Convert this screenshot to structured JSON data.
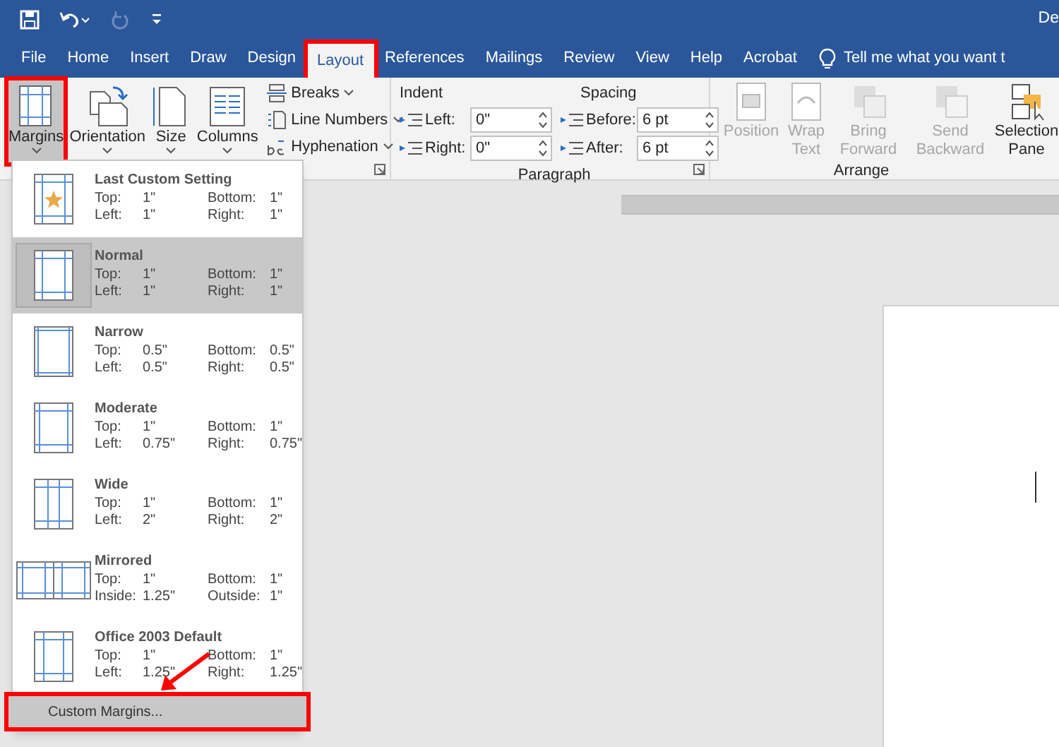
{
  "title_bar": {
    "title": "De"
  },
  "tabs": [
    {
      "label": "File",
      "selected": false,
      "highlighted": false
    },
    {
      "label": "Home",
      "selected": false,
      "highlighted": false
    },
    {
      "label": "Insert",
      "selected": false,
      "highlighted": false
    },
    {
      "label": "Draw",
      "selected": false,
      "highlighted": false
    },
    {
      "label": "Design",
      "selected": false,
      "highlighted": false
    },
    {
      "label": "Layout",
      "selected": true,
      "highlighted": true
    },
    {
      "label": "References",
      "selected": false,
      "highlighted": false
    },
    {
      "label": "Mailings",
      "selected": false,
      "highlighted": false
    },
    {
      "label": "Review",
      "selected": false,
      "highlighted": false
    },
    {
      "label": "View",
      "selected": false,
      "highlighted": false
    },
    {
      "label": "Help",
      "selected": false,
      "highlighted": false
    },
    {
      "label": "Acrobat",
      "selected": false,
      "highlighted": false
    }
  ],
  "tell_me": {
    "text": "Tell me what you want t"
  },
  "page_setup": {
    "large_buttons": [
      {
        "kind": "margins",
        "label": "Margins",
        "pressed": true,
        "highlighted": true
      },
      {
        "kind": "orientation",
        "label": "Orientation",
        "pressed": false,
        "highlighted": false
      },
      {
        "kind": "size",
        "label": "Size",
        "pressed": false,
        "highlighted": false
      },
      {
        "kind": "columns",
        "label": "Columns",
        "pressed": false,
        "highlighted": false
      }
    ],
    "small_buttons": [
      {
        "kind": "breaks",
        "label": "Breaks"
      },
      {
        "kind": "line_numbers",
        "label": "Line Numbers"
      },
      {
        "kind": "hyphenation",
        "label": "Hyphenation"
      }
    ]
  },
  "paragraph": {
    "group_label": "Paragraph",
    "indent": {
      "label": "Indent",
      "left": {
        "label": "Left:",
        "value": "0\""
      },
      "right": {
        "label": "Right:",
        "value": "0\""
      }
    },
    "spacing": {
      "label": "Spacing",
      "before": {
        "label": "Before:",
        "value": "6 pt"
      },
      "after": {
        "label": "After:",
        "value": "6 pt"
      }
    }
  },
  "arrange": {
    "group_label": "Arrange",
    "buttons": [
      {
        "kind": "position",
        "lines": [
          "Position"
        ],
        "disabled": true
      },
      {
        "kind": "wrap",
        "lines": [
          "Wrap",
          "Text"
        ],
        "disabled": true
      },
      {
        "kind": "forward",
        "lines": [
          "Bring",
          "Forward"
        ],
        "disabled": true
      },
      {
        "kind": "backward",
        "lines": [
          "Send",
          "Backward"
        ],
        "disabled": true
      },
      {
        "kind": "selection",
        "lines": [
          "Selection",
          "Pane"
        ],
        "disabled": false
      }
    ]
  },
  "margins_menu": {
    "items": [
      {
        "kind": "custom",
        "name": "Last Custom Setting",
        "selected": false,
        "fields": [
          {
            "label": "Top:",
            "value": "1\""
          },
          {
            "label": "Bottom:",
            "value": "1\""
          },
          {
            "label": "Left:",
            "value": "1\""
          },
          {
            "label": "Right:",
            "value": "1\""
          }
        ]
      },
      {
        "kind": "normal",
        "name": "Normal",
        "selected": true,
        "fields": [
          {
            "label": "Top:",
            "value": "1\""
          },
          {
            "label": "Bottom:",
            "value": "1\""
          },
          {
            "label": "Left:",
            "value": "1\""
          },
          {
            "label": "Right:",
            "value": "1\""
          }
        ]
      },
      {
        "kind": "narrow",
        "name": "Narrow",
        "selected": false,
        "fields": [
          {
            "label": "Top:",
            "value": "0.5\""
          },
          {
            "label": "Bottom:",
            "value": "0.5\""
          },
          {
            "label": "Left:",
            "value": "0.5\""
          },
          {
            "label": "Right:",
            "value": "0.5\""
          }
        ]
      },
      {
        "kind": "moderate",
        "name": "Moderate",
        "selected": false,
        "fields": [
          {
            "label": "Top:",
            "value": "1\""
          },
          {
            "label": "Bottom:",
            "value": "1\""
          },
          {
            "label": "Left:",
            "value": "0.75\""
          },
          {
            "label": "Right:",
            "value": "0.75\""
          }
        ]
      },
      {
        "kind": "wide",
        "name": "Wide",
        "selected": false,
        "fields": [
          {
            "label": "Top:",
            "value": "1\""
          },
          {
            "label": "Bottom:",
            "value": "1\""
          },
          {
            "label": "Left:",
            "value": "2\""
          },
          {
            "label": "Right:",
            "value": "2\""
          }
        ]
      },
      {
        "kind": "mirrored",
        "name": "Mirrored",
        "selected": false,
        "fields": [
          {
            "label": "Top:",
            "value": "1\""
          },
          {
            "label": "Bottom:",
            "value": "1\""
          },
          {
            "label": "Inside:",
            "value": "1.25\""
          },
          {
            "label": "Outside:",
            "value": "1\""
          }
        ]
      },
      {
        "kind": "office2003",
        "name": "Office 2003 Default",
        "selected": false,
        "fields": [
          {
            "label": "Top:",
            "value": "1\""
          },
          {
            "label": "Bottom:",
            "value": "1\""
          },
          {
            "label": "Left:",
            "value": "1.25\""
          },
          {
            "label": "Right:",
            "value": "1.25\""
          }
        ]
      }
    ],
    "custom": {
      "label": "Custom Margins...",
      "highlighted": true
    }
  }
}
